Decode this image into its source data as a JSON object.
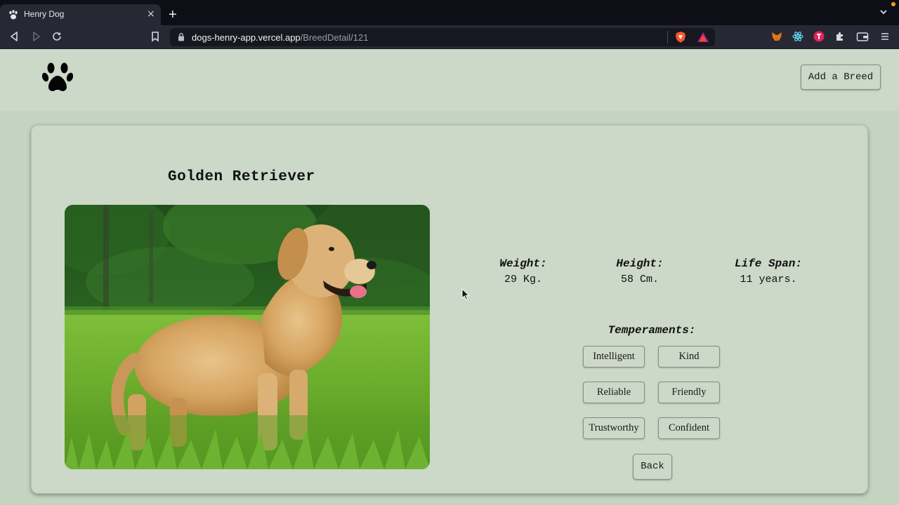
{
  "browser": {
    "tab_title": "Henry Dog",
    "tab_close": "×",
    "new_tab": "+",
    "url_host": "dogs-henry-app.vercel.app",
    "url_path": "/BreedDetail/121"
  },
  "header": {
    "add_breed_label": "Add a Breed"
  },
  "breed": {
    "name": "Golden Retriever",
    "stats": [
      {
        "label": "Weight:",
        "value": "29 Kg."
      },
      {
        "label": "Height:",
        "value": "58 Cm."
      },
      {
        "label": "Life Span:",
        "value": "11 years."
      }
    ],
    "temperaments_label": "Temperaments:",
    "temperaments": [
      "Intelligent",
      "Kind",
      "Reliable",
      "Friendly",
      "Trustworthy",
      "Confident"
    ],
    "back_label": "Back"
  },
  "colors": {
    "page_bg": "#c3d4c0",
    "card_bg": "#ccd8c8",
    "chrome_dark": "#0e0f16",
    "chrome_toolbar": "#272833",
    "brave_orange": "#fb542b"
  }
}
